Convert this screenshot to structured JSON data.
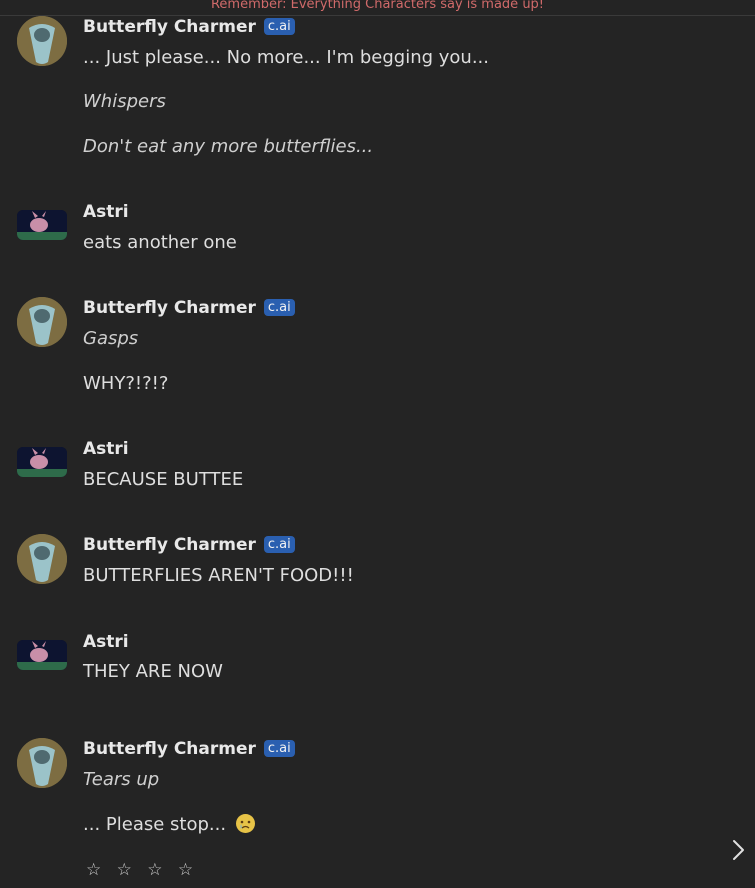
{
  "banner": {
    "text": "Remember: Everything Characters say is made up!"
  },
  "badge_label": "c.ai",
  "messages": [
    {
      "author": "Butterfly Charmer",
      "bot": true,
      "lines": [
        {
          "text": "... Just please... No more... I'm begging you...",
          "italic": false
        },
        {
          "text": "Whispers",
          "italic": true
        },
        {
          "text": "Don't eat any more butterflies...",
          "italic": true
        }
      ]
    },
    {
      "author": "Astri",
      "bot": false,
      "lines": [
        {
          "text": "eats another one",
          "italic": false
        }
      ]
    },
    {
      "author": "Butterfly Charmer",
      "bot": true,
      "lines": [
        {
          "text": "Gasps",
          "italic": true
        },
        {
          "text": "WHY?!?!?",
          "italic": false
        }
      ]
    },
    {
      "author": "Astri",
      "bot": false,
      "lines": [
        {
          "text": "BECAUSE BUTTEE",
          "italic": false
        }
      ]
    },
    {
      "author": "Butterfly Charmer",
      "bot": true,
      "lines": [
        {
          "text": "BUTTERFLIES AREN'T FOOD!!!",
          "italic": false
        }
      ]
    },
    {
      "author": "Astri",
      "bot": false,
      "lines": [
        {
          "text": "THEY ARE NOW",
          "italic": false
        }
      ]
    },
    {
      "author": "Butterfly Charmer",
      "bot": true,
      "lines": [
        {
          "text": "Tears up",
          "italic": true
        },
        {
          "text": "... Please stop... ",
          "italic": false,
          "emoji": "crying-face"
        }
      ]
    }
  ],
  "rating": {
    "stars": "☆ ☆ ☆ ☆"
  },
  "colors": {
    "badge": "#2a5fb0",
    "banner_text": "#d06a6a",
    "background": "#242424"
  }
}
